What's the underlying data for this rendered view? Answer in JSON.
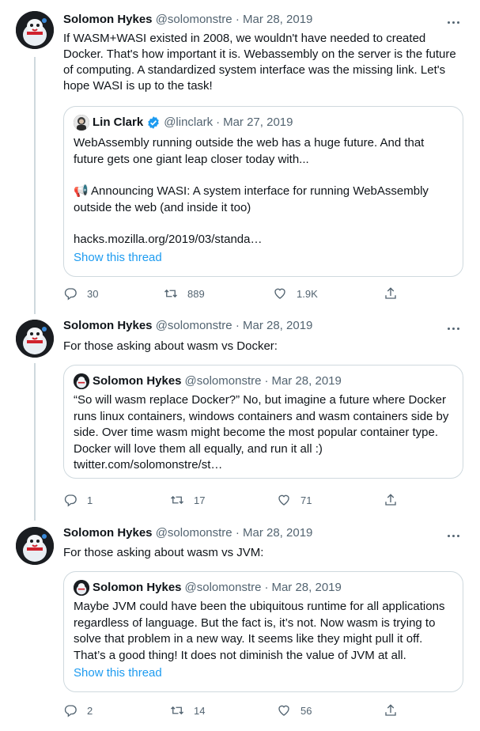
{
  "tweets": [
    {
      "name": "Solomon Hykes",
      "handle": "@solomonstre",
      "dot": "·",
      "date": "Mar 28, 2019",
      "text": "If WASM+WASI existed in 2008, we wouldn't have needed to created Docker. That's how important it is. Webassembly on the server is the future of computing. A standardized system interface was the missing link. Let's hope WASI is up to the task!",
      "quote": {
        "name": "Lin Clark",
        "handle": "@linclark",
        "date": "Mar 27, 2019",
        "para1": "WebAssembly running outside the web has a huge future. And that future gets one giant leap closer today with...",
        "para2_emoji": "📢",
        "para2": "Announcing WASI: A system interface for running WebAssembly outside the web (and inside it too)",
        "link": "hacks.mozilla.org/2019/03/standa…",
        "show_thread": "Show this thread"
      },
      "replies": "30",
      "retweets": "889",
      "likes": "1.9K"
    },
    {
      "name": "Solomon Hykes",
      "handle": "@solomonstre",
      "dot": "·",
      "date": "Mar 28, 2019",
      "text": "For those asking about wasm vs Docker:",
      "quote": {
        "name": "Solomon Hykes",
        "handle": "@solomonstre",
        "date": "Mar 28, 2019",
        "body": "“So will wasm replace Docker?” No, but imagine a future where Docker runs linux containers, windows containers and wasm containers side by side. Over time wasm might become the most popular container type. Docker will love them all equally, and run it all :)",
        "link": "twitter.com/solomonstre/st…"
      },
      "replies": "1",
      "retweets": "17",
      "likes": "71"
    },
    {
      "name": "Solomon Hykes",
      "handle": "@solomonstre",
      "dot": "·",
      "date": "Mar 28, 2019",
      "text": "For those asking about wasm vs JVM:",
      "quote": {
        "name": "Solomon Hykes",
        "handle": "@solomonstre",
        "date": "Mar 28, 2019",
        "body": "Maybe JVM could have been the ubiquitous runtime for all applications regardless of language. But the fact is, it’s not. Now wasm is trying to solve that problem in a new way. It seems like they might pull it off. That’s a good thing! It does not diminish the value of JVM at all.",
        "show_thread": "Show this thread"
      },
      "replies": "2",
      "retweets": "14",
      "likes": "56"
    }
  ],
  "colors": {
    "text": "#0f1419",
    "secondary": "#536471",
    "link": "#1d9bf0",
    "border": "#cfd9de",
    "verified": "#1d9bf0",
    "avatar_bg": "#1a1d21"
  }
}
